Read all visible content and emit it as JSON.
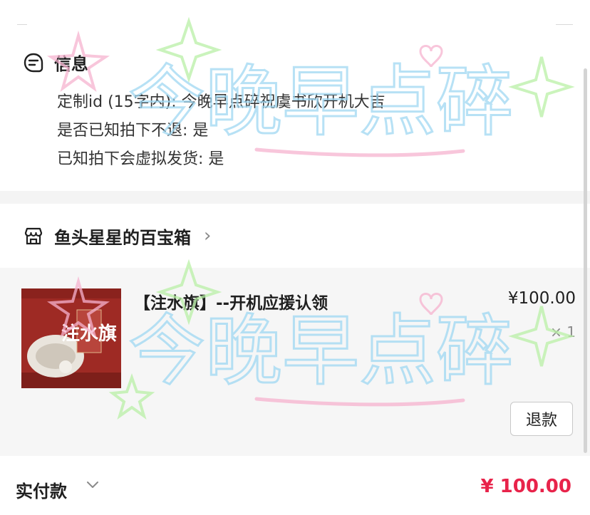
{
  "info": {
    "title": "信息",
    "lines": [
      "定制id (15字内): 今晚早点碎祝虞书欣开机大吉",
      "是否已知拍下不退: 是",
      "已知拍下会虚拟发货: 是"
    ]
  },
  "shop": {
    "name": "鱼头星星的百宝箱",
    "chevron": "›"
  },
  "item": {
    "title": "【注水旗】--开机应援认领",
    "price": "¥100.00",
    "qty": "× 1",
    "refund_label": "退款",
    "thumb_text": "注水旗"
  },
  "payment": {
    "label": "实付款",
    "amount": "¥ 100.00"
  },
  "watermark": {
    "text": "今晚早点碎",
    "colors": [
      "#9fd8f2",
      "#f6b3cf",
      "#b9f0a6"
    ]
  },
  "colors": {
    "price_red": "#e8234a",
    "thumb_bg": "#9e2a24"
  }
}
